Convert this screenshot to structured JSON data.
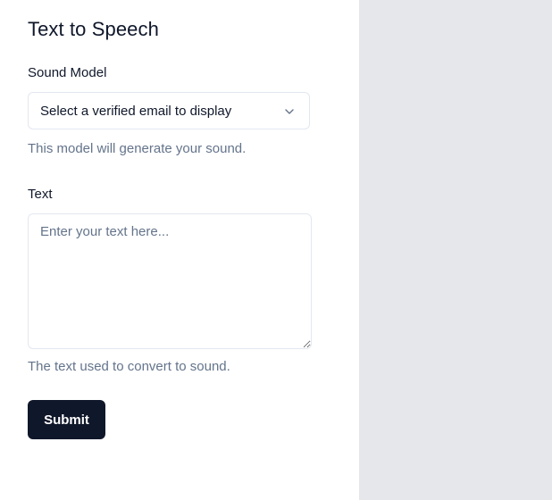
{
  "form": {
    "title": "Text to Speech",
    "sound_model": {
      "label": "Sound Model",
      "selected_value": "Select a verified email to display",
      "hint": "This model will generate your sound."
    },
    "text": {
      "label": "Text",
      "value": "",
      "placeholder": "Enter your text here...",
      "hint": "The text used to convert to sound."
    },
    "submit_label": "Submit"
  },
  "colors": {
    "primary": "#0f172a",
    "muted_text": "#64748b",
    "border": "#e2e8f0",
    "side_panel": "#e5e7eb"
  },
  "icons": {
    "select_chevron": "chevron-down-icon"
  }
}
